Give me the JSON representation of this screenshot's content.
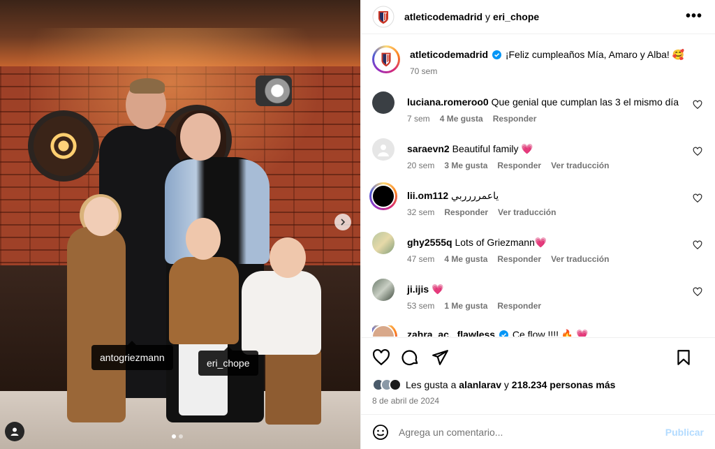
{
  "post": {
    "header": {
      "account": "atleticodemadrid",
      "joiner": "y",
      "coauthor": "eri_chope"
    },
    "caption": {
      "username": "atleticodemadrid",
      "text": "¡Feliz cumpleaños Mía, Amaro y Alba! 🥰",
      "time": "70 sem"
    },
    "photo_tags": [
      "antogriezmann",
      "eri_chope"
    ],
    "carousel": {
      "slides": 2,
      "current": 1
    }
  },
  "comments": [
    {
      "username": "luciana.romeroo0",
      "text": "Que genial que cumplan las 3 el mismo día",
      "time": "7 sem",
      "likes": "4 Me gusta",
      "reply": "Responder",
      "translate": ""
    },
    {
      "username": "saraevn2",
      "text": "Beautiful family 💗",
      "time": "20 sem",
      "likes": "3 Me gusta",
      "reply": "Responder",
      "translate": "Ver traducción"
    },
    {
      "username": "lii.om112",
      "text": "ياعمرررربي",
      "time": "32 sem",
      "likes": "",
      "reply": "Responder",
      "translate": "Ver traducción"
    },
    {
      "username": "ghy2555q",
      "text": "Lots of Griezmann💗",
      "time": "47 sem",
      "likes": "4 Me gusta",
      "reply": "Responder",
      "translate": "Ver traducción"
    },
    {
      "username": "ji.ijis",
      "text": "💗",
      "time": "53 sem",
      "likes": "1 Me gusta",
      "reply": "Responder",
      "translate": ""
    },
    {
      "username": "zahra_ac._flawless",
      "text": "Ce flow !!!! 🔥 💗",
      "time": "",
      "likes": "",
      "reply": "",
      "translate": ""
    }
  ],
  "likes_line": {
    "prefix": "Les gusta a",
    "user": "alanlarav",
    "mid": "y",
    "count": "218.234 personas más"
  },
  "date": "8 de abril de 2024",
  "add_comment": {
    "placeholder": "Agrega un comentario...",
    "publish": "Publicar"
  },
  "colors": {
    "brand_red": "#cb3524",
    "brand_blue": "#262e61",
    "link_blue": "#b3dbff",
    "verified": "#0095f6"
  }
}
